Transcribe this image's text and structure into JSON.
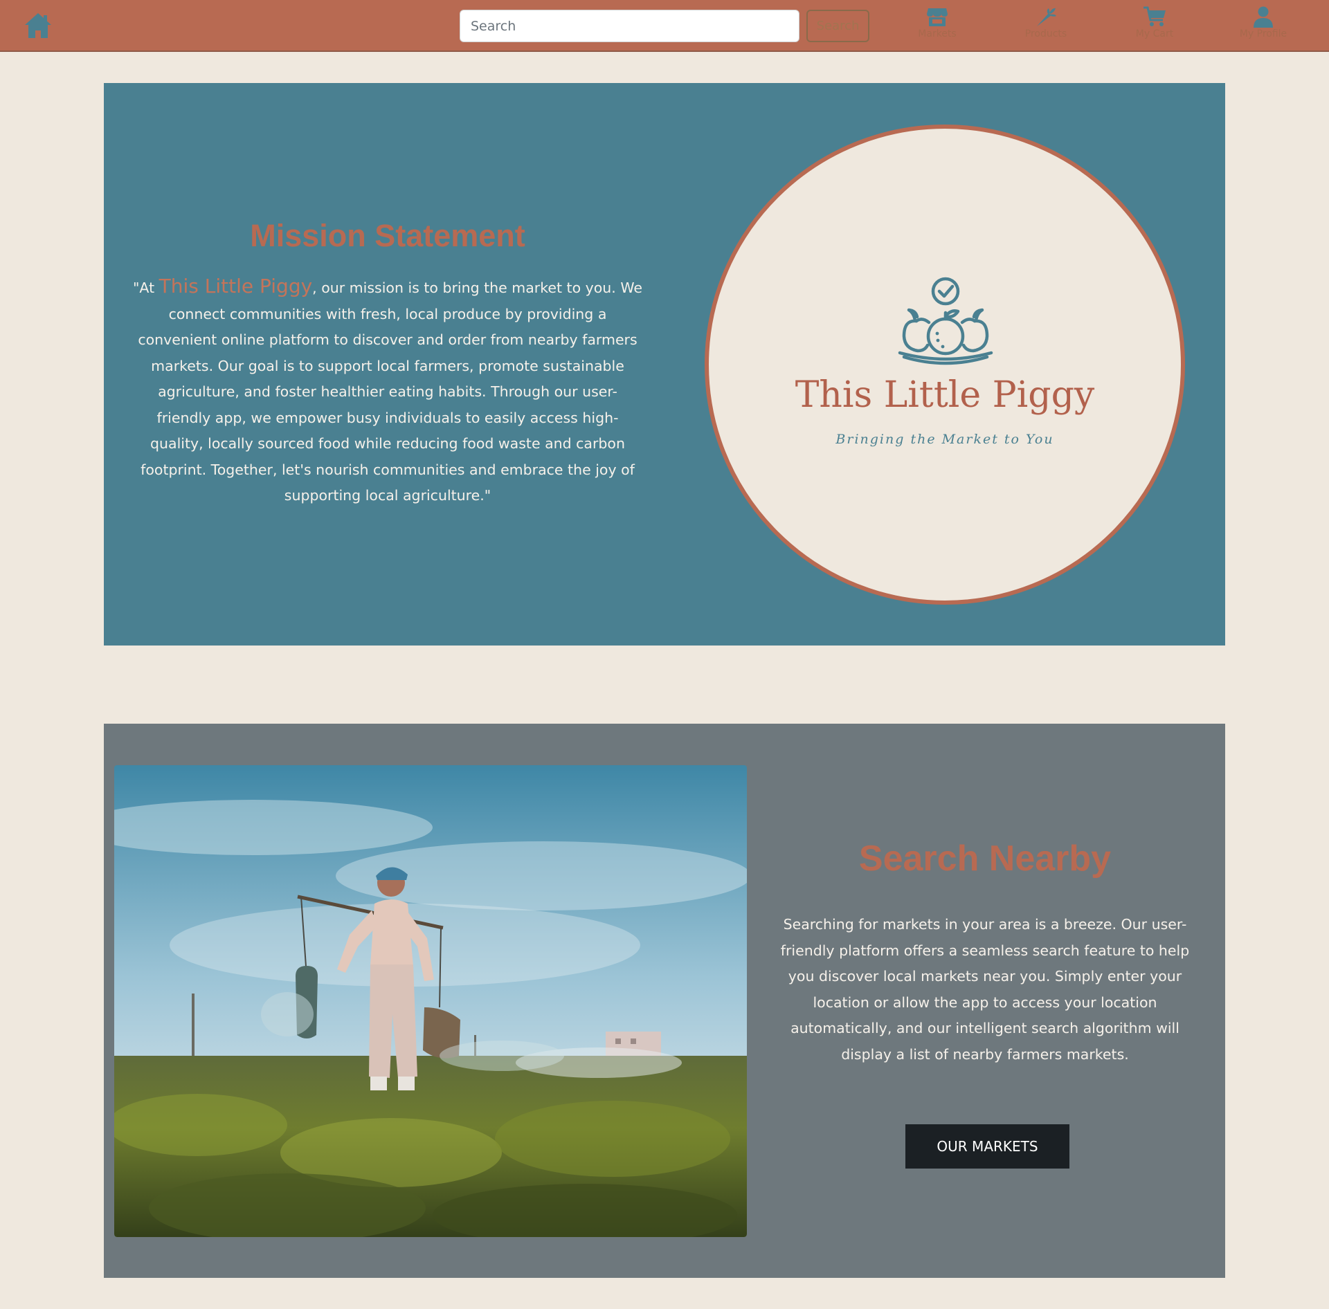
{
  "navbar": {
    "search_placeholder": "Search",
    "search_button_label": "Search",
    "items": [
      {
        "label": "Markets",
        "icon": "market-store-icon"
      },
      {
        "label": "Products",
        "icon": "carrot-icon"
      },
      {
        "label": "My Cart",
        "icon": "shopping-cart-icon"
      },
      {
        "label": "My Profile",
        "icon": "user-icon"
      }
    ]
  },
  "mission": {
    "title": "Mission Statement",
    "text_prefix": "\"At ",
    "brand": "This Little Piggy",
    "text_suffix": ", our mission is to bring the market to you. We connect communities with fresh, local produce by providing a convenient online platform to discover and order from nearby farmers markets. Our goal is to support local farmers, promote sustainable agriculture, and foster healthier eating habits. Through our user-friendly app, we empower busy individuals to easily access high-quality, locally sourced food while reducing food waste and carbon footprint. Together, let's nourish communities and embrace the joy of supporting local agriculture.\""
  },
  "logo": {
    "name": "This Little Piggy",
    "tagline": "Bringing the Market to You"
  },
  "nearby": {
    "title": "Search Nearby",
    "text": "Searching for markets in your area is a breeze. Our user-friendly platform offers a seamless search feature to help you discover local markets near you. Simply enter your location or allow the app to access your location automatically, and our intelligent search algorithm will display a list of nearby farmers markets.",
    "button_label": "OUR MARKETS"
  },
  "colors": {
    "navbar": "#b86a52",
    "page_background": "#efe8de",
    "mission_panel": "#4a8091",
    "nearby_panel": "#6e787d",
    "accent": "#b86a52",
    "button_dark": "#1b2024"
  }
}
